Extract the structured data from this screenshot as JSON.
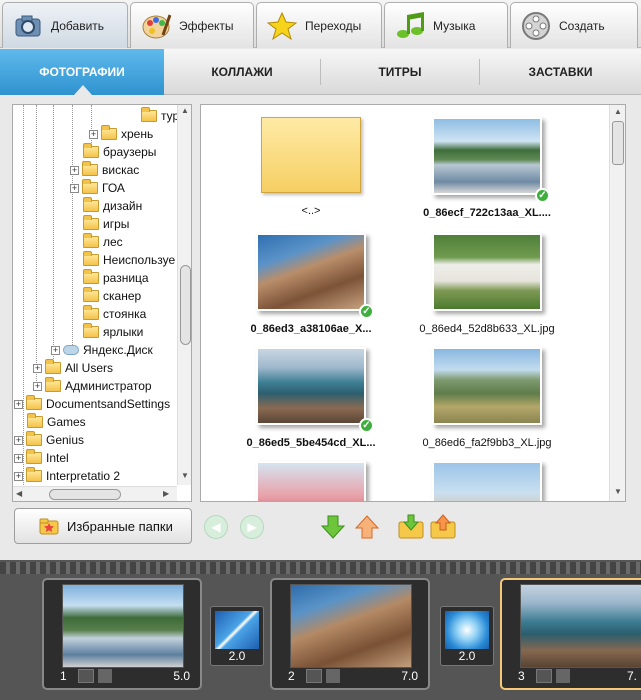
{
  "top_tabs": [
    {
      "label": "Добавить",
      "icon": "camera-icon",
      "active": true
    },
    {
      "label": "Эффекты",
      "icon": "palette-icon"
    },
    {
      "label": "Переходы",
      "icon": "star-icon"
    },
    {
      "label": "Музыка",
      "icon": "music-note-icon"
    },
    {
      "label": "Создать",
      "icon": "film-reel-icon"
    }
  ],
  "sub_tabs": [
    {
      "label": "ФОТОГРАФИИ",
      "active": true
    },
    {
      "label": "КОЛЛАЖИ"
    },
    {
      "label": "ТИТРЫ"
    },
    {
      "label": "ЗАСТАВКИ"
    }
  ],
  "tree": [
    {
      "label": "тур",
      "toggle": ""
    },
    {
      "label": "хрень",
      "toggle": "+"
    },
    {
      "label": "браузеры",
      "toggle": ""
    },
    {
      "label": "вискас",
      "toggle": "+"
    },
    {
      "label": "ГОА",
      "toggle": "+"
    },
    {
      "label": "дизайн",
      "toggle": ""
    },
    {
      "label": "игры",
      "toggle": ""
    },
    {
      "label": "лес",
      "toggle": ""
    },
    {
      "label": "Неиспользуе",
      "toggle": ""
    },
    {
      "label": "разница",
      "toggle": ""
    },
    {
      "label": "сканер",
      "toggle": ""
    },
    {
      "label": "стоянка",
      "toggle": ""
    },
    {
      "label": "ярлыки",
      "toggle": ""
    },
    {
      "label": "Яндекс.Диск",
      "toggle": "+"
    },
    {
      "label": "All Users",
      "toggle": "+"
    },
    {
      "label": "Администратор",
      "toggle": "+"
    },
    {
      "label": "DocumentsandSettings",
      "toggle": "+"
    },
    {
      "label": "Games",
      "toggle": ""
    },
    {
      "label": "Genius",
      "toggle": "+"
    },
    {
      "label": "Intel",
      "toggle": "+"
    },
    {
      "label": "Interpretatio 2",
      "toggle": "+"
    }
  ],
  "files": [
    {
      "name": "<..>",
      "type": "folder-up"
    },
    {
      "name": "0_86ecf_722c13aa_XL....",
      "checked": true,
      "bold": true
    },
    {
      "name": "0_86ed3_a38106ae_X...",
      "checked": true,
      "bold": true
    },
    {
      "name": "0_86ed4_52d8b633_XL.jpg",
      "checked": false,
      "bold": false
    },
    {
      "name": "0_86ed5_5be454cd_XL...",
      "checked": true,
      "bold": true
    },
    {
      "name": "0_86ed6_fa2f9bb3_XL.jpg",
      "checked": false,
      "bold": false
    },
    {
      "name": "",
      "checked": false
    },
    {
      "name": "",
      "checked": false
    }
  ],
  "favorites_button": "Избранные папки",
  "timeline": {
    "slides": [
      {
        "num": "1",
        "duration": "5.0"
      },
      {
        "num": "2",
        "duration": "7.0"
      },
      {
        "num": "3",
        "duration": "7."
      }
    ],
    "transitions": [
      {
        "duration": "2.0"
      },
      {
        "duration": "2.0"
      }
    ]
  },
  "colors": {
    "accent": "#3a9fd8",
    "check": "#3eaf3e",
    "selected_slide": "#f6c979"
  }
}
